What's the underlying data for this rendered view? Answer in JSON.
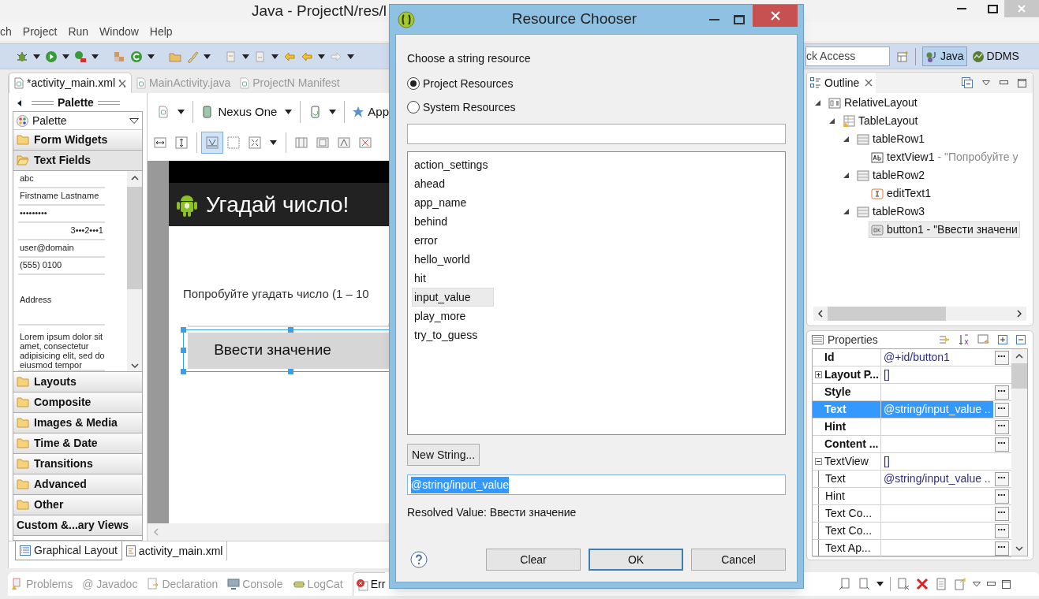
{
  "window": {
    "title": "Java - ProjectN/res/l"
  },
  "menu": [
    "ch",
    "Project",
    "Run",
    "Window",
    "Help"
  ],
  "quick_access": {
    "value": "ck Access"
  },
  "perspectives": [
    {
      "label": "Java",
      "selected": true
    },
    {
      "label": "DDMS",
      "selected": false
    }
  ],
  "editor": {
    "tabs": [
      {
        "label": "*activity_main.xml",
        "selected": true
      },
      {
        "label": "MainActivity.java",
        "selected": false
      },
      {
        "label": "ProjectN Manifest",
        "selected": false
      }
    ],
    "palette": {
      "title": "Palette",
      "dropdown": "Palette",
      "categories": [
        {
          "kind": "folder",
          "label": "Form Widgets",
          "expanded": false
        },
        {
          "kind": "folder",
          "label": "Text Fields",
          "expanded": true,
          "items": [
            {
              "kind": "single",
              "text": "abc"
            },
            {
              "kind": "single",
              "text": "Firstname Lastname"
            },
            {
              "kind": "single",
              "text": "•••••••••"
            },
            {
              "kind": "right",
              "text": "3•••2•••1"
            },
            {
              "kind": "single",
              "text": "user@domain"
            },
            {
              "kind": "single",
              "text": "(555) 0100"
            },
            {
              "kind": "tall",
              "text": "Address"
            },
            {
              "kind": "multi",
              "text": "Lorem ipsum dolor sit amet, consectetur adipisicing elit, sed do eiusmod tempor"
            }
          ]
        },
        {
          "kind": "folder",
          "label": "Layouts",
          "expanded": false
        },
        {
          "kind": "folder",
          "label": "Composite",
          "expanded": false
        },
        {
          "kind": "folder",
          "label": "Images & Media",
          "expanded": false
        },
        {
          "kind": "folder",
          "label": "Time & Date",
          "expanded": false
        },
        {
          "kind": "folder",
          "label": "Transitions",
          "expanded": false
        },
        {
          "kind": "folder",
          "label": "Advanced",
          "expanded": false
        },
        {
          "kind": "folder",
          "label": "Other",
          "expanded": false
        },
        {
          "kind": "plain",
          "label": "Custom &...ary Views",
          "expanded": false
        }
      ]
    },
    "device": "Nexus One",
    "theme": "App",
    "screen": {
      "app_title": "Угадай число!",
      "text": "Попробуйте угадать число (1 – 10",
      "button": "Ввести значение",
      "button_selected": true
    },
    "bottom_tabs": [
      {
        "label": "Graphical Layout",
        "selected": true
      },
      {
        "label": "activity_main.xml",
        "selected": false
      }
    ]
  },
  "outline": {
    "title": "Outline",
    "tree": [
      {
        "kind": "relative",
        "label": "RelativeLayout",
        "selected": false,
        "expanded": true,
        "children": [
          {
            "kind": "table",
            "label": "TableLayout",
            "selected": false,
            "expanded": true,
            "children": [
              {
                "kind": "row",
                "label": "tableRow1",
                "selected": false,
                "expanded": true,
                "children": [
                  {
                    "kind": "text",
                    "label": "textView1",
                    "detail": "- \"Попробуйте у",
                    "selected": false
                  }
                ]
              },
              {
                "kind": "row",
                "label": "tableRow2",
                "selected": false,
                "expanded": true,
                "children": [
                  {
                    "kind": "edit",
                    "label": "editText1",
                    "selected": false
                  }
                ]
              },
              {
                "kind": "row",
                "label": "tableRow3",
                "selected": false,
                "expanded": true,
                "children": [
                  {
                    "kind": "button",
                    "label": "button1 - \"Ввести значени",
                    "selected": true
                  }
                ]
              }
            ]
          }
        ]
      }
    ]
  },
  "properties": {
    "title": "Properties",
    "rows": [
      {
        "kind": "property",
        "name": "Id",
        "value": "@+id/button1",
        "bold": true,
        "selected": false,
        "button": true
      },
      {
        "kind": "group",
        "name": "Layout P...",
        "value": "[]",
        "bold": true,
        "selected": false,
        "expanded": false,
        "button": false
      },
      {
        "kind": "property",
        "name": "Style",
        "bold": true,
        "selected": false,
        "button": true
      },
      {
        "kind": "property",
        "name": "Text",
        "value": "@string/input_value ..",
        "bold": true,
        "selected": true,
        "button": true
      },
      {
        "kind": "property",
        "name": "Hint",
        "bold": true,
        "selected": false,
        "button": true
      },
      {
        "kind": "property",
        "name": "Content ...",
        "bold": true,
        "selected": false,
        "button": true
      },
      {
        "kind": "group",
        "name": "TextView",
        "value": "[]",
        "bold": false,
        "selected": false,
        "expanded": true,
        "button": false,
        "children": [
          {
            "kind": "property",
            "name": "Text",
            "value": "@string/input_value ..",
            "bold": false,
            "selected": false,
            "button": true
          },
          {
            "kind": "property",
            "name": "Hint",
            "bold": false,
            "selected": false,
            "button": true
          },
          {
            "kind": "property",
            "name": "Text Co...",
            "bold": false,
            "selected": false,
            "button": true
          },
          {
            "kind": "property",
            "name": "Text Co...",
            "bold": false,
            "selected": false,
            "button": true
          },
          {
            "kind": "property",
            "name": "Text Ap...",
            "bold": false,
            "selected": false,
            "button": true
          }
        ]
      }
    ]
  },
  "views": [
    {
      "kind": "problems",
      "label": "Problems",
      "selected": false
    },
    {
      "kind": "javadoc",
      "label": "@ Javadoc",
      "selected": false
    },
    {
      "kind": "declaration",
      "label": "Declaration",
      "selected": false
    },
    {
      "kind": "console",
      "label": "Console",
      "selected": false
    },
    {
      "kind": "logcat",
      "label": "LogCat",
      "selected": false
    },
    {
      "kind": "error",
      "label": "Err",
      "selected": true
    }
  ],
  "dialog": {
    "title": "Resource Chooser",
    "prompt": "Choose a string resource",
    "sources": [
      {
        "label": "Project Resources",
        "selected": true
      },
      {
        "label": "System Resources",
        "selected": false
      }
    ],
    "resources": [
      {
        "label": "action_settings",
        "selected": false
      },
      {
        "label": "ahead",
        "selected": false
      },
      {
        "label": "app_name",
        "selected": false
      },
      {
        "label": "behind",
        "selected": false
      },
      {
        "label": "error",
        "selected": false
      },
      {
        "label": "hello_world",
        "selected": false
      },
      {
        "label": "hit",
        "selected": false
      },
      {
        "label": "input_value",
        "selected": true
      },
      {
        "label": "play_more",
        "selected": false
      },
      {
        "label": "try_to_guess",
        "selected": false
      }
    ],
    "new_button": "New String...",
    "reference": {
      "value": "@string/input_value",
      "highlighted": true
    },
    "resolved": "Resolved Value: Ввести значение",
    "buttons": [
      {
        "label": "Clear",
        "default": false
      },
      {
        "label": "OK",
        "default": true
      },
      {
        "label": "Cancel",
        "default": false
      }
    ]
  }
}
